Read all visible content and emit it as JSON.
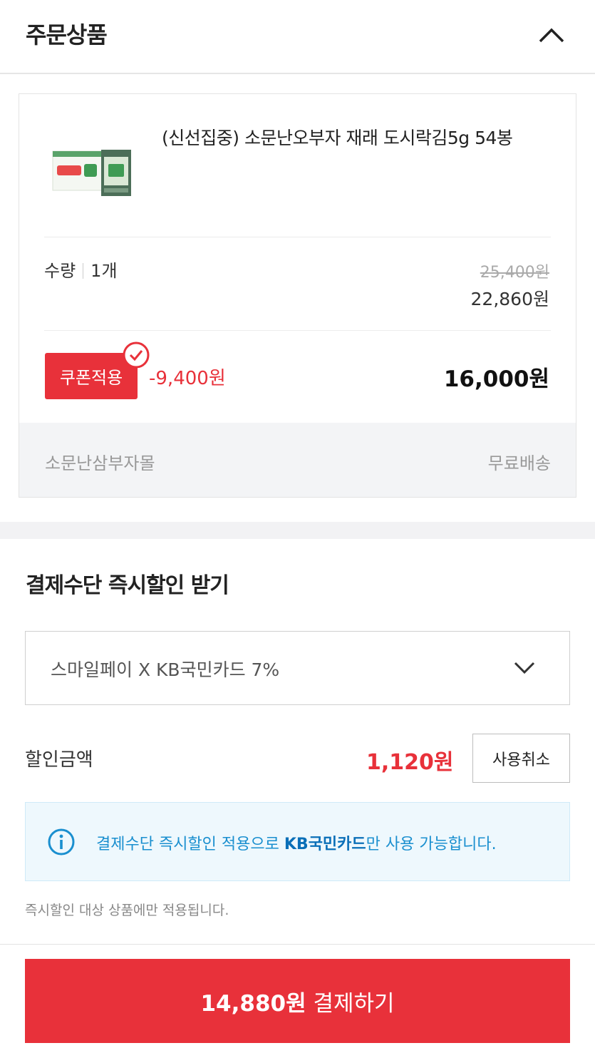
{
  "header": {
    "title": "주문상품",
    "collapse_icon": "chevron-up-icon"
  },
  "product": {
    "name": "(신선집중) 소문난오부자 재래 도시락김5g 54봉",
    "quantity_label": "수량",
    "quantity_value": "1개",
    "original_price": "25,400원",
    "sale_price": "22,860원",
    "coupon_label": "쿠폰적용",
    "coupon_discount": "-9,400원",
    "final_price": "16,000원",
    "seller": "소문난삼부자몰",
    "shipping": "무료배송"
  },
  "payment_discount": {
    "title": "결제수단 즉시할인 받기",
    "selected_option": "스마일페이 X KB국민카드 7%",
    "discount_label": "할인금액",
    "discount_amount": "1,120원",
    "cancel_label": "사용취소",
    "info_pre": "결제수단 즉시할인 적용으로 ",
    "info_bold": "KB국민카드",
    "info_post": "만 사용 가능합니다.",
    "note": "즉시할인 대상 상품에만 적용됩니다."
  },
  "checkout": {
    "amount": "14,880원",
    "label": " 결제하기"
  },
  "colors": {
    "accent": "#e8313a",
    "info": "#1a8fcf",
    "info_bg": "#eef8fd"
  }
}
